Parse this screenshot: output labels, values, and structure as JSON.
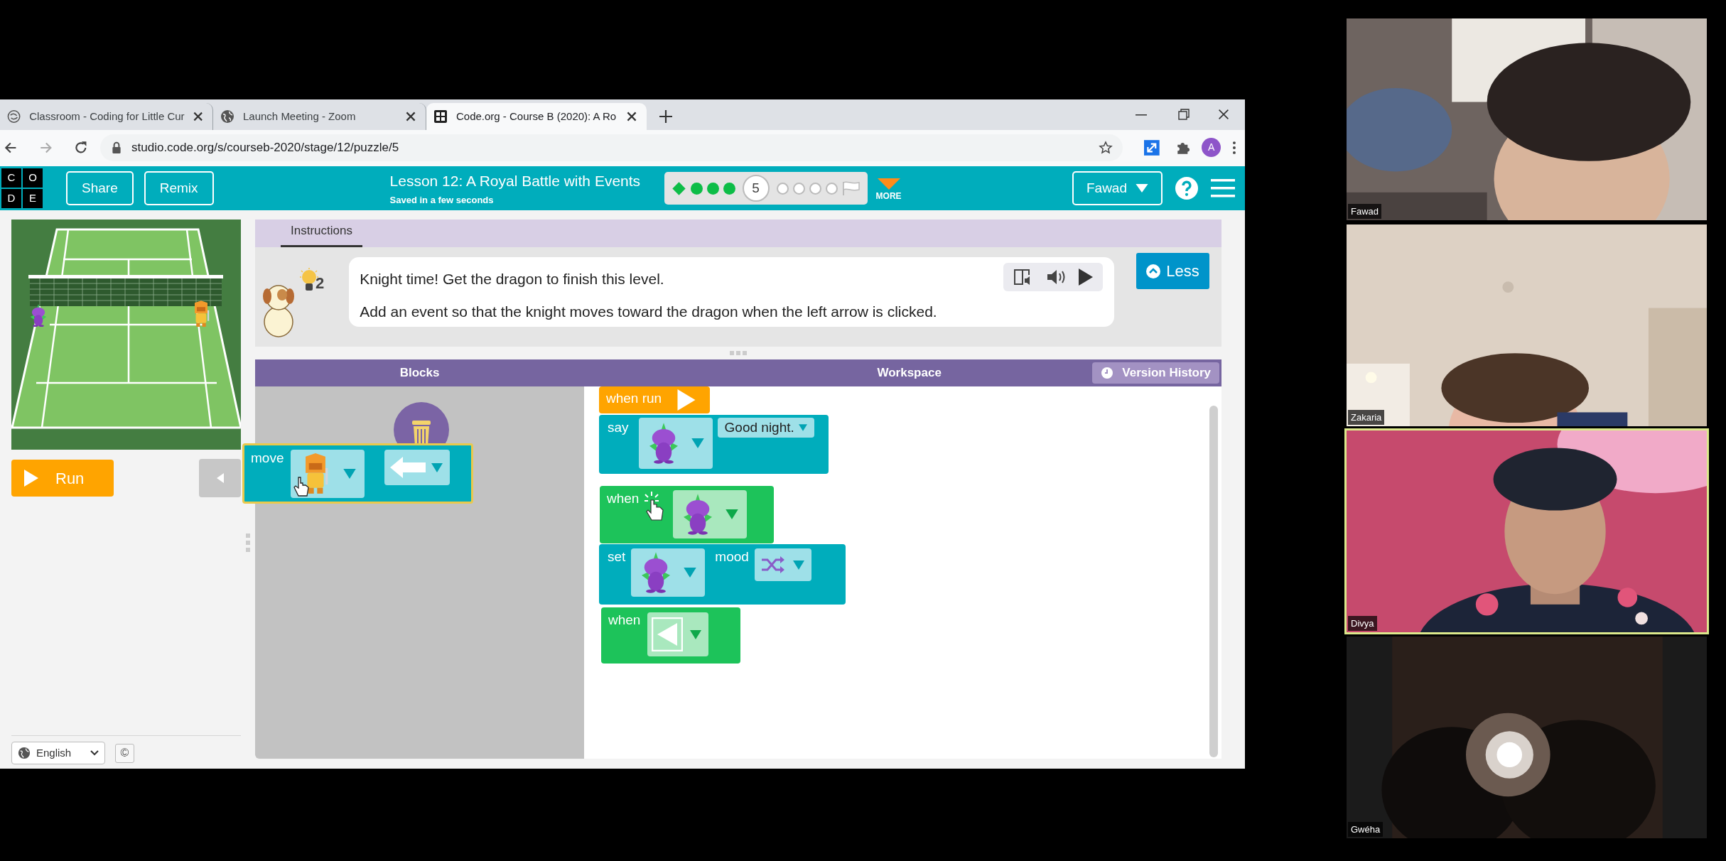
{
  "browser": {
    "tabs": [
      {
        "title": "Classroom - Coding for Little Cur",
        "selected": false
      },
      {
        "title": "Launch Meeting - Zoom",
        "selected": false
      },
      {
        "title": "Code.org - Course B (2020): A Ro",
        "selected": true
      }
    ],
    "url": "studio.code.org/s/courseb-2020/stage/12/puzzle/5",
    "profile_initial": "A"
  },
  "header": {
    "logo_letters": [
      "C",
      "O",
      "D",
      "E"
    ],
    "buttons": [
      "Share",
      "Remix"
    ],
    "lesson_title": "Lesson 12: A Royal Battle with Events",
    "save_status": "Saved in a few seconds",
    "progress": [
      {
        "kind": "diamond",
        "completed": true,
        "selected": false
      },
      {
        "kind": "circle",
        "completed": true,
        "selected": false
      },
      {
        "kind": "circle",
        "completed": true,
        "selected": false
      },
      {
        "kind": "circle",
        "completed": true,
        "selected": false
      },
      {
        "selected": true,
        "label": "5"
      },
      {
        "kind": "circle",
        "completed": false,
        "selected": false
      },
      {
        "kind": "circle",
        "completed": false,
        "selected": false
      },
      {
        "kind": "circle",
        "completed": false,
        "selected": false
      },
      {
        "kind": "circle",
        "completed": false,
        "selected": false
      }
    ],
    "more_label": "MORE",
    "user_menu": "Fawad"
  },
  "game": {
    "run_button": "Run"
  },
  "instructions": {
    "tab": "Instructions",
    "hint_count": "2",
    "lines": [
      "Knight time! Get the dragon to finish this level.",
      "Add an event so that the knight moves toward the dragon when the left arrow is clicked."
    ],
    "less_button": "Less"
  },
  "editor": {
    "blocks_header": "Blocks",
    "workspace_header": "Workspace",
    "version_history": "Version History",
    "dragged_block": {
      "kind": "move",
      "label": "move"
    },
    "blocks": [
      {
        "kind": "when_run",
        "label": "when run"
      },
      {
        "kind": "say",
        "label": "say",
        "text": "Good night."
      },
      {
        "kind": "when_clicked",
        "label": "when"
      },
      {
        "kind": "set_mood",
        "label": "set",
        "property": "mood"
      },
      {
        "kind": "when_arrow",
        "label": "when"
      }
    ]
  },
  "footer": {
    "language": "English",
    "copyright_symbol": "©"
  },
  "participants": [
    {
      "name": "Fawad",
      "active_speaker": false
    },
    {
      "name": "Zakaria",
      "active_speaker": false
    },
    {
      "name": "Divya",
      "active_speaker": true
    },
    {
      "name": "Gwéha",
      "active_speaker": false
    }
  ]
}
